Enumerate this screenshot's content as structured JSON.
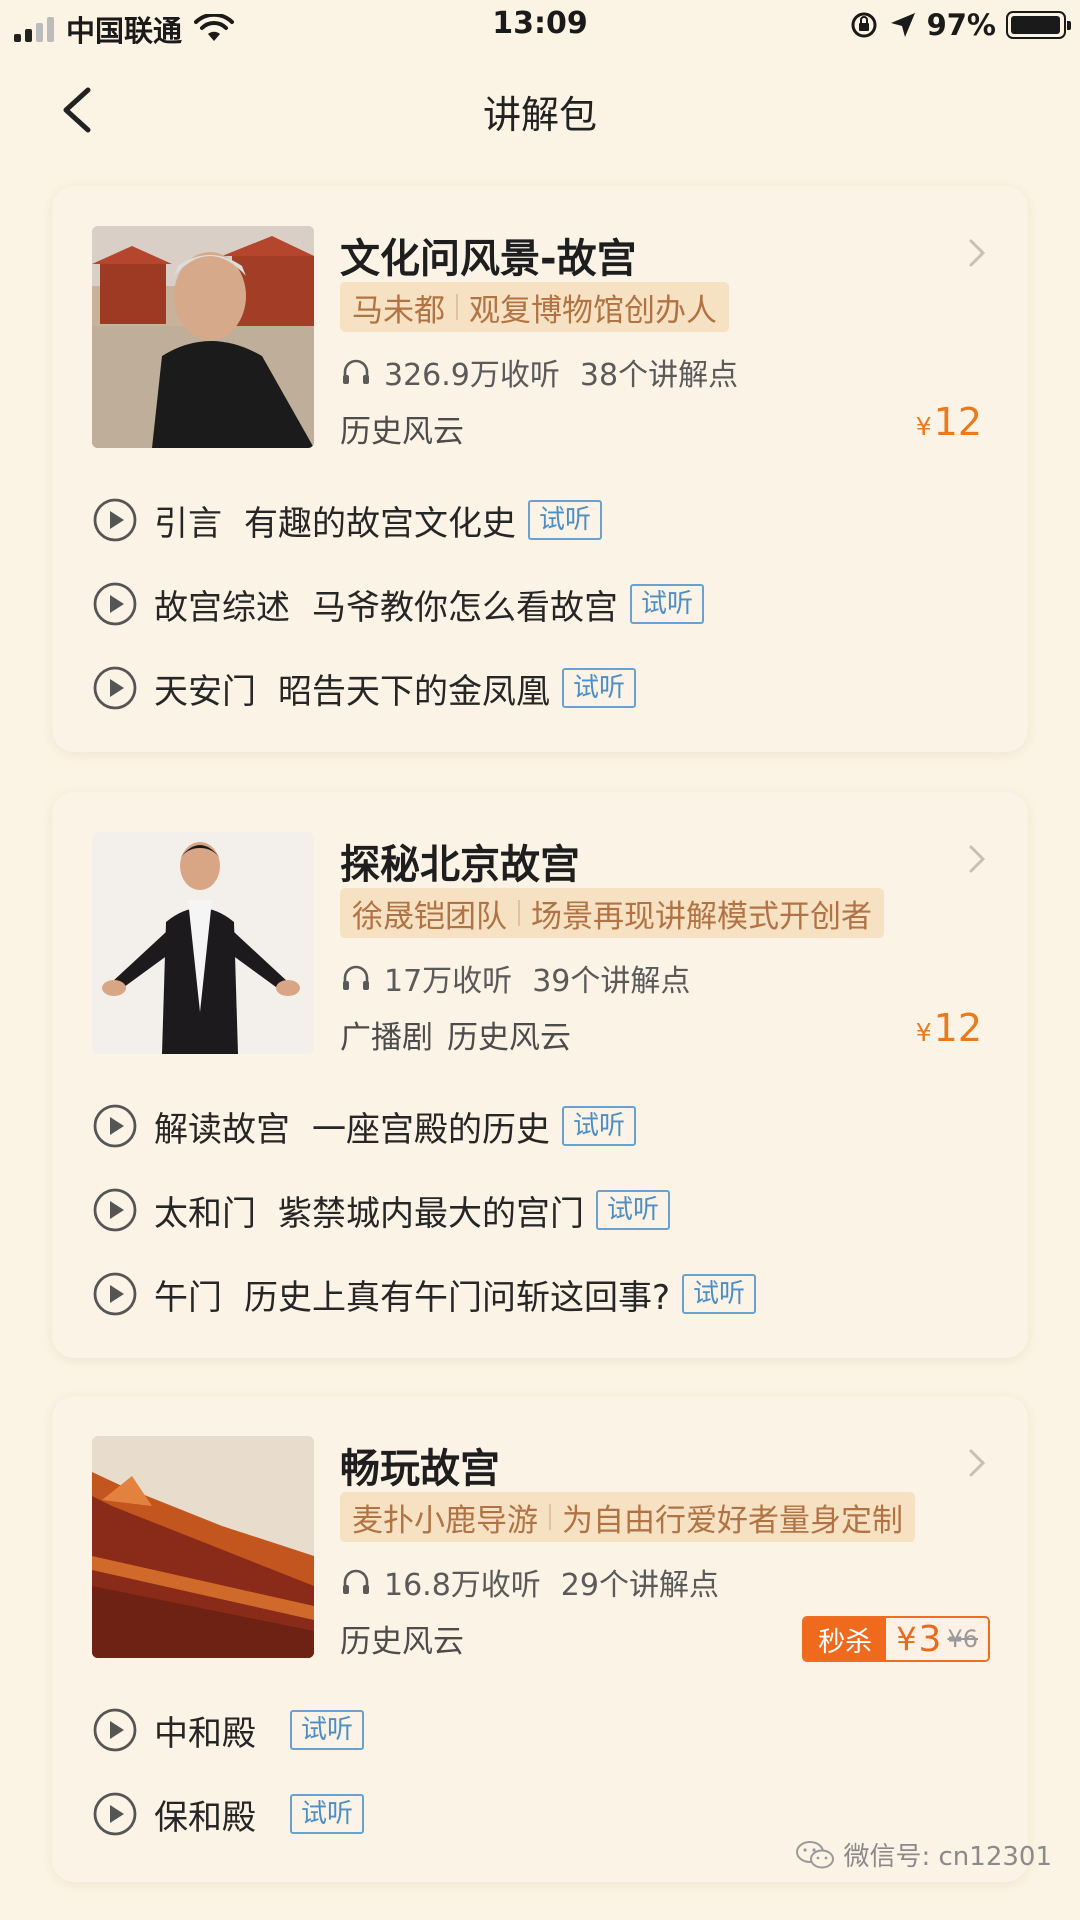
{
  "status_bar": {
    "carrier": "中国联通",
    "time": "13:09",
    "battery": "97%",
    "battery_level": 0.97
  },
  "nav": {
    "title": "讲解包"
  },
  "packages": [
    {
      "title": "文化问风景-故宫",
      "author": "马未都",
      "author_role": "观复博物馆创办人",
      "listens": "326.9万收听",
      "points": "38个讲解点",
      "tags": [
        "历史风云"
      ],
      "price_symbol": "¥",
      "price": "12",
      "tracks": [
        {
          "name": "引言",
          "desc": "有趣的故宫文化史",
          "trial": "试听"
        },
        {
          "name": "故宫综述",
          "desc": "马爷教你怎么看故宫",
          "trial": "试听"
        },
        {
          "name": "天安门",
          "desc": "昭告天下的金凤凰",
          "trial": "试听"
        }
      ]
    },
    {
      "title": "探秘北京故宫",
      "author": "徐晟铠团队",
      "author_role": "场景再现讲解模式开创者",
      "listens": "17万收听",
      "points": "39个讲解点",
      "tags": [
        "广播剧",
        "历史风云"
      ],
      "price_symbol": "¥",
      "price": "12",
      "tracks": [
        {
          "name": "解读故宫",
          "desc": "一座宫殿的历史",
          "trial": "试听"
        },
        {
          "name": "太和门",
          "desc": "紫禁城内最大的宫门",
          "trial": "试听"
        },
        {
          "name": "午门",
          "desc": "历史上真有午门问斩这回事?",
          "trial": "试听"
        }
      ]
    },
    {
      "title": "畅玩故宫",
      "author": "麦扑小鹿导游",
      "author_role": "为自由行爱好者量身定制",
      "listens": "16.8万收听",
      "points": "29个讲解点",
      "tags": [
        "历史风云"
      ],
      "flash_label": "秒杀",
      "price_symbol": "¥",
      "price": "3",
      "old_price": "¥6",
      "tracks": [
        {
          "name": "中和殿",
          "desc": "",
          "trial": "试听"
        },
        {
          "name": "保和殿",
          "desc": "",
          "trial": "试听"
        }
      ]
    }
  ],
  "watermark": "微信号: cn12301",
  "colors": {
    "background": "#fbf3e3",
    "price": "#ea7a1c",
    "trial_blue": "#4e8ec6",
    "author_bg": "#f6e1c3",
    "author_text": "#b17343",
    "flash_red": "#ef6a1c"
  },
  "icons": {
    "back": "chevron-left-icon",
    "chevron": "chevron-right-icon",
    "listens": "headphones-icon",
    "track": "play-circle-icon"
  }
}
